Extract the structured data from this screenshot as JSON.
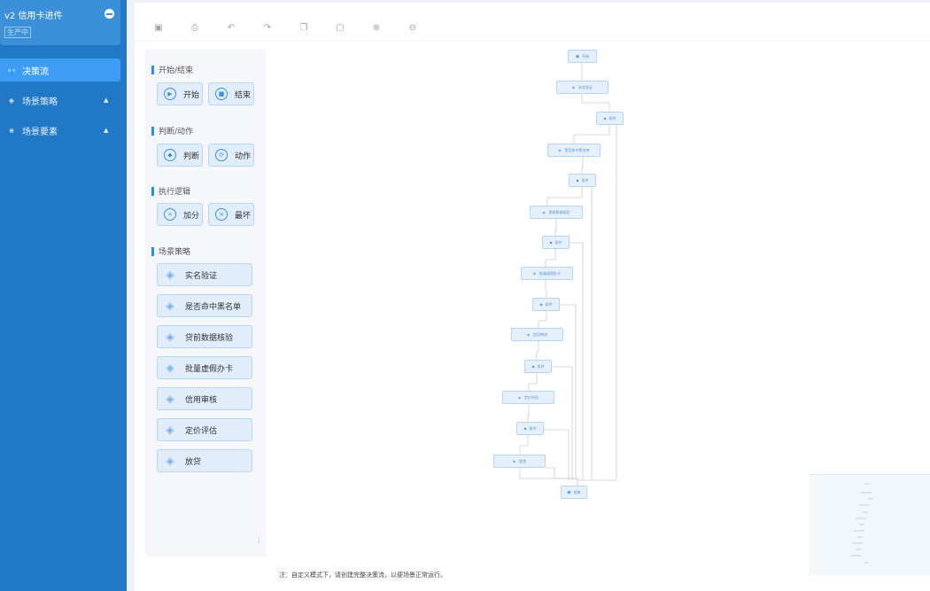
{
  "sidebar": {
    "app_title": "v2 信用卡进件",
    "status_badge": "生产中",
    "items": [
      {
        "label": "决策流",
        "icon": "flow-icon",
        "active": true
      },
      {
        "label": "场景策略",
        "icon": "layers-icon",
        "active": false
      },
      {
        "label": "场景要素",
        "icon": "grid-icon",
        "active": false
      }
    ]
  },
  "toolbar": {
    "icons": [
      "save-icon",
      "print-icon",
      "undo-icon",
      "redo-icon",
      "copy-icon",
      "delete-icon",
      "zoom-in-icon",
      "zoom-out-icon"
    ]
  },
  "palette": {
    "groups": [
      {
        "title": "开始/结束",
        "items": [
          "开始",
          "结束"
        ]
      },
      {
        "title": "判断/动作",
        "items": [
          "判断",
          "动作"
        ]
      },
      {
        "title": "执行逻辑",
        "items": [
          "加分",
          "最坏"
        ]
      },
      {
        "title": "场景策略",
        "items": [
          "实名验证",
          "是否命中黑名单",
          "贷前数据核验",
          "批量虚假办卡",
          "信用审核",
          "定价评估",
          "放贷"
        ]
      }
    ]
  },
  "flow": {
    "start": "开始",
    "condition": "条件",
    "end": "结束",
    "strategies": [
      "实名验证",
      "是否命中黑名单",
      "贷前数据核验",
      "批量虚假办卡",
      "信用审核",
      "定价评估",
      "放贷"
    ]
  },
  "footnote": "注：自定义模式下，请创建完整决策流，以便场景正常运行。",
  "colors": {
    "sidebar_bg": "#2178c6",
    "accent": "#3d9df5",
    "node_bg": "#e6f0fc"
  }
}
